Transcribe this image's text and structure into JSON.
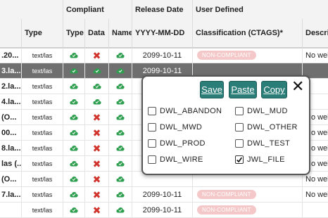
{
  "header": {
    "group_compliant": "Compliant",
    "group_release": "Release Date",
    "group_user": "User Defined",
    "col_type": "Type",
    "col_c_type": "Type",
    "col_c_data": "Data",
    "col_c_name": "Name",
    "col_date": "YYYY-MM-DD",
    "col_class": "Classification (CTAGS)*",
    "col_desc": "Descri"
  },
  "rows": [
    {
      "name": ".20...",
      "type": "text/las",
      "c_type": "check",
      "c_data": "cross",
      "c_name": "check",
      "date": "2099-10-11",
      "badge": "NON-COMPLIANT",
      "desc": "No wel",
      "selected": false
    },
    {
      "name": "3.la...",
      "type": "text/las",
      "c_type": "check",
      "c_data": "check",
      "c_name": "check",
      "date": "2099-10-11",
      "badge": "",
      "desc": "",
      "selected": true
    },
    {
      "name": "2.la...",
      "type": "text/las",
      "c_type": "check",
      "c_data": "check",
      "c_name": "check",
      "date": "",
      "badge": "",
      "desc": "",
      "selected": false
    },
    {
      "name": "4.la...",
      "type": "text/las",
      "c_type": "check",
      "c_data": "check",
      "c_name": "check",
      "date": "",
      "badge": "",
      "desc": "",
      "selected": false
    },
    {
      "name": "(O...",
      "type": "text/las",
      "c_type": "check",
      "c_data": "cross",
      "c_name": "check",
      "date": "",
      "badge": "",
      "desc": "No wel",
      "selected": false
    },
    {
      "name": "00...",
      "type": "text/las",
      "c_type": "check",
      "c_data": "cross",
      "c_name": "check",
      "date": "",
      "badge": "",
      "desc": "No wel",
      "selected": false
    },
    {
      "name": "8.la...",
      "type": "text/las",
      "c_type": "check",
      "c_data": "cross",
      "c_name": "check",
      "date": "",
      "badge": "",
      "desc": "No wel",
      "selected": false
    },
    {
      "name": "las (...",
      "type": "text/las",
      "c_type": "check",
      "c_data": "cross",
      "c_name": "check",
      "date": "",
      "badge": "",
      "desc": "No wel",
      "selected": false
    },
    {
      "name": "(O...",
      "type": "text/las",
      "c_type": "check",
      "c_data": "cross",
      "c_name": "check",
      "date": "",
      "badge": "",
      "desc": "No wel",
      "selected": false
    },
    {
      "name": "7.la...",
      "type": "text/las",
      "c_type": "check",
      "c_data": "cross",
      "c_name": "check",
      "date": "2099-10-11",
      "badge": "NON-COMPLIANT",
      "desc": "No wel",
      "selected": false
    },
    {
      "name": "",
      "type": "text/las",
      "c_type": "check",
      "c_data": "cross",
      "c_name": "check",
      "date": "2099-10-11",
      "badge": "NON-COMPLIANT",
      "desc": "",
      "selected": false
    }
  ],
  "popup": {
    "save_label": "Save",
    "paste_label": "Paste",
    "copy_label": "Copy",
    "close_label": "✕",
    "options": [
      {
        "label": "DWL_ABANDON",
        "checked": false
      },
      {
        "label": "DWL_MUD",
        "checked": false
      },
      {
        "label": "DWL_MWD",
        "checked": false
      },
      {
        "label": "DWL_OTHER",
        "checked": false
      },
      {
        "label": "DWL_PROD",
        "checked": false
      },
      {
        "label": "DWL_TEST",
        "checked": false
      },
      {
        "label": "DWL_WIRE",
        "checked": false
      },
      {
        "label": "JWL_FILE",
        "checked": true
      }
    ]
  },
  "colors": {
    "check": "#2e9e4f",
    "cross": "#d0342c",
    "button": "#2b7d78",
    "badge": "#f4c8c8",
    "selected_row": "#6f6f6f"
  }
}
